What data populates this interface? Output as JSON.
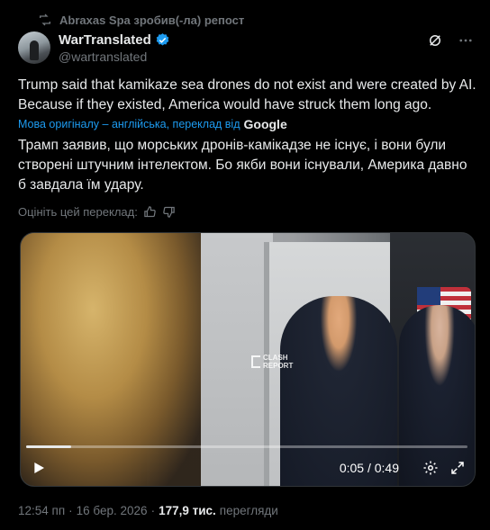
{
  "repost": {
    "text": "Abraxas Spa зробив(-ла) репост",
    "icon": "repost-icon"
  },
  "author": {
    "name": "WarTranslated",
    "handle": "@wartranslated",
    "verified_color": "#1d9bf0"
  },
  "tweet": {
    "text": "Trump said that kamikaze sea drones do not exist and were created by AI. Because if they existed, America would have struck them long ago.",
    "translation_label": "Мова оригіналу – англійська, переклад від",
    "translation_provider": "Google",
    "translated_text": "Трамп заявив, що морських дронів-камікадзе не існує, і вони були створені штучним інтелектом. Бо якби вони існували, Америка давно б завдала їм удару.",
    "rate_label": "Оцініть цей переклад:"
  },
  "video": {
    "watermark_line1": "CLASH",
    "watermark_line2": "REPORT",
    "time": "0:05 / 0:49",
    "progress": 0.102
  },
  "meta": {
    "time": "12:54 пп",
    "separator": "·",
    "date": "16 бер. 2026",
    "views_count": "177,9 тис.",
    "views_label": "перегляди"
  },
  "colors": {
    "accent": "#1d9bf0",
    "muted": "#71767b",
    "text": "#e7e9ea",
    "background": "#000000"
  }
}
